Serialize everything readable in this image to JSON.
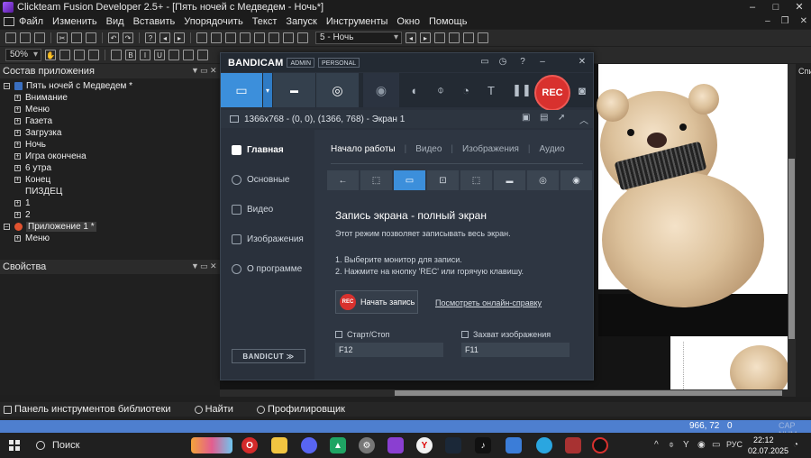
{
  "window": {
    "title": "Clickteam Fusion Developer 2.5+ - [Пять ночей с Медведем - Ночь*]",
    "controls": [
      "–",
      "□",
      "✕"
    ]
  },
  "menu": [
    "Файл",
    "Изменить",
    "Вид",
    "Вставить",
    "Упорядочить",
    "Текст",
    "Запуск",
    "Инструменты",
    "Окно",
    "Помощь"
  ],
  "toolbar": {
    "frame_select": "5 - Ночь",
    "zoom": "50%"
  },
  "workspace": {
    "title": "Состав приложения",
    "project": "Пять ночей с Медведем *",
    "frames": [
      "Внимание",
      "Меню",
      "Газета",
      "Загрузка",
      "Ночь",
      "Игра окончена",
      "6 утра",
      "Конец",
      "ПИЗДЕЦ",
      "1",
      "2"
    ],
    "app2": "Приложение 1 *",
    "app2_frames": [
      "Меню"
    ]
  },
  "properties": {
    "title": "Свойства"
  },
  "right_panel": {
    "label": "Спи"
  },
  "bottom_tabs": [
    "Панель инструментов библиотеки",
    "Найти",
    "Профилировщик"
  ],
  "status": {
    "coords": "966, 72",
    "objects": "0",
    "caps": "CAP NUM"
  },
  "bandicam": {
    "logo": "BANDICAM",
    "badges": [
      "ADMIN",
      "PERSONAL"
    ],
    "rec": "REC",
    "target": "1366x768 - (0, 0), (1366, 768) - Экран 1",
    "sidebar": [
      "Главная",
      "Основные",
      "Видео",
      "Изображения",
      "О программе"
    ],
    "bandicut": "BANDICUT ≫",
    "tabs": [
      "Начало работы",
      "Видео",
      "Изображения",
      "Аудио"
    ],
    "heading": "Запись экрана - полный экран",
    "description": "Этот режим позволяет записывать весь экран.",
    "step1": "1. Выберите монитор для записи.",
    "step2": "2. Нажмите на кнопку 'REC' или горячую клавишу.",
    "start_button": "Начать запись",
    "start_dot": "REC",
    "help_link": "Посмотреть онлайн-справку",
    "hotkey_start_label": "Старт/Стоп",
    "hotkey_start_value": "F12",
    "hotkey_capture_label": "Захват изображения",
    "hotkey_capture_value": "F11"
  },
  "taskbar": {
    "search": "Поиск",
    "lang": "РУС",
    "time": "22:12",
    "date": "02.07.2025"
  },
  "colors": {
    "accent": "#3c8fdb",
    "rec": "#d8312e",
    "statusbar": "#4e7fcf"
  }
}
